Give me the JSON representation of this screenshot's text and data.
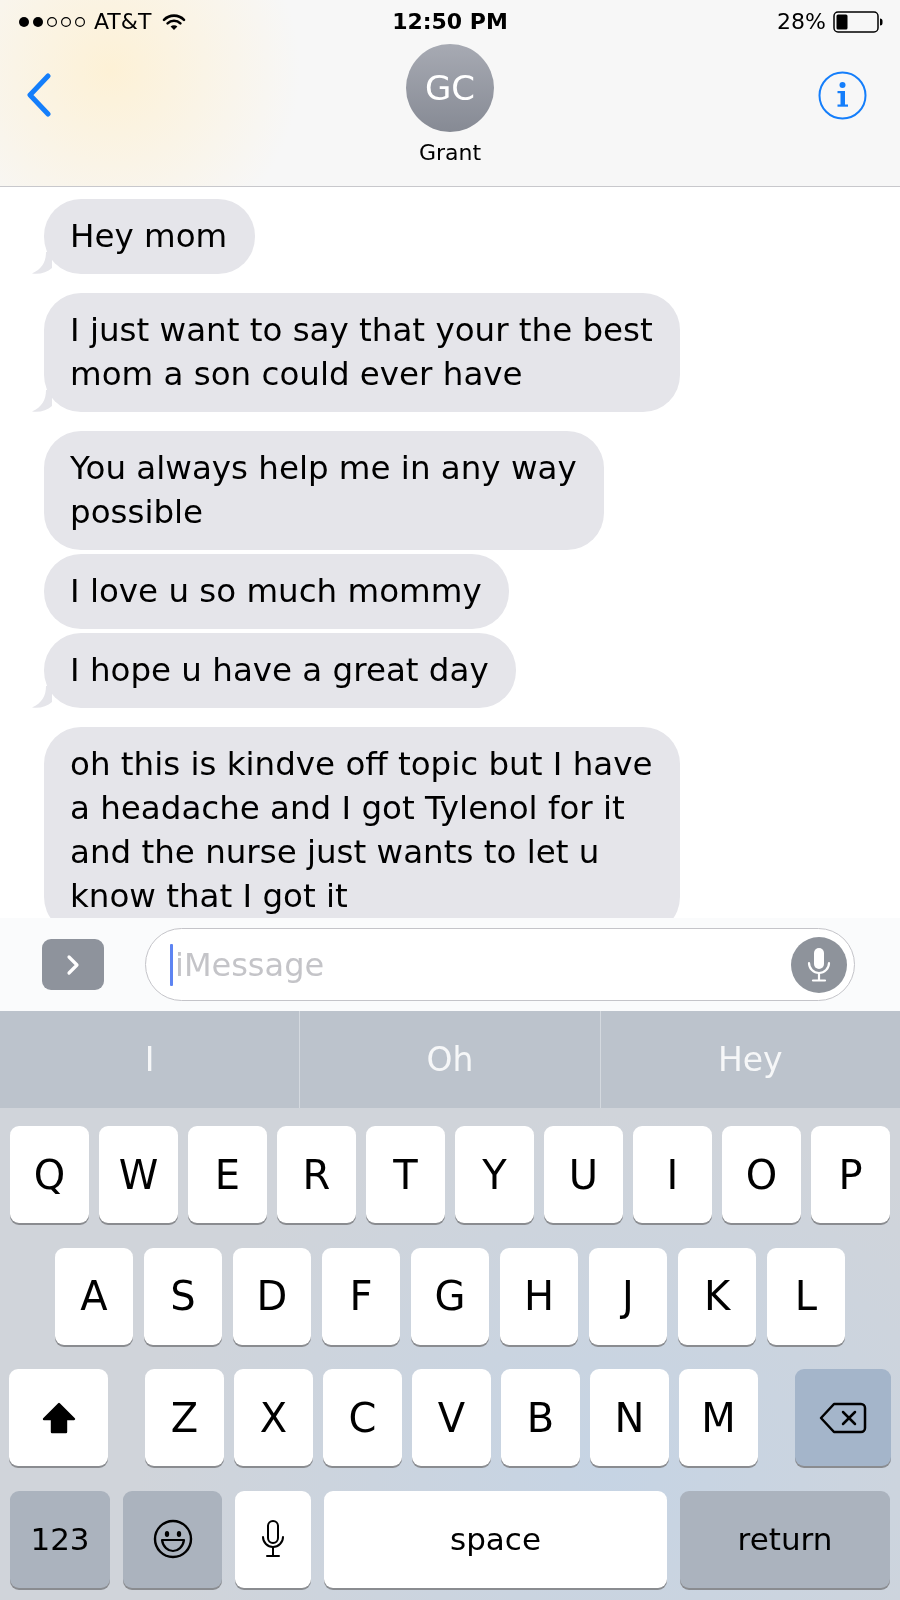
{
  "status_bar": {
    "carrier": "AT&T",
    "time": "12:50 PM",
    "battery": "28%"
  },
  "header": {
    "avatar_initials": "GC",
    "contact_name": "Grant"
  },
  "messages": [
    {
      "text": "Hey mom",
      "tail": true
    },
    {
      "text": "I just want to say that your the best mom a son could ever have",
      "tail": true
    },
    {
      "text": "You always help me in any way possible",
      "tail": false
    },
    {
      "text": "I love u so much mommy",
      "tail": false
    },
    {
      "text": "I hope u have a great day",
      "tail": true
    },
    {
      "text": "oh this is kindve off topic but I have a headache and I got Tylenol for it and the nurse just wants to let u know that I got it",
      "tail": false
    }
  ],
  "composer": {
    "placeholder": "iMessage"
  },
  "keyboard": {
    "suggestions": [
      "I",
      "Oh",
      "Hey"
    ],
    "rows": [
      {
        "keys": [
          {
            "kind": "letter",
            "label": "Q"
          },
          {
            "kind": "letter",
            "label": "W"
          },
          {
            "kind": "letter",
            "label": "E"
          },
          {
            "kind": "letter",
            "label": "R"
          },
          {
            "kind": "letter",
            "label": "T"
          },
          {
            "kind": "letter",
            "label": "Y"
          },
          {
            "kind": "letter",
            "label": "U"
          },
          {
            "kind": "letter",
            "label": "I"
          },
          {
            "kind": "letter",
            "label": "O"
          },
          {
            "kind": "letter",
            "label": "P"
          }
        ]
      },
      {
        "keys": [
          {
            "kind": "letter",
            "label": "A"
          },
          {
            "kind": "letter",
            "label": "S"
          },
          {
            "kind": "letter",
            "label": "D"
          },
          {
            "kind": "letter",
            "label": "F"
          },
          {
            "kind": "letter",
            "label": "G"
          },
          {
            "kind": "letter",
            "label": "H"
          },
          {
            "kind": "letter",
            "label": "J"
          },
          {
            "kind": "letter",
            "label": "K"
          },
          {
            "kind": "letter",
            "label": "L"
          }
        ]
      },
      {
        "keys": [
          {
            "kind": "shift",
            "on": true
          },
          {
            "kind": "letter",
            "label": "Z"
          },
          {
            "kind": "letter",
            "label": "X"
          },
          {
            "kind": "letter",
            "label": "C"
          },
          {
            "kind": "letter",
            "label": "V"
          },
          {
            "kind": "letter",
            "label": "B"
          },
          {
            "kind": "letter",
            "label": "N"
          },
          {
            "kind": "letter",
            "label": "M"
          },
          {
            "kind": "delete"
          }
        ]
      },
      {
        "keys": [
          {
            "kind": "mode",
            "label": "123"
          },
          {
            "kind": "emoji"
          },
          {
            "kind": "dictation"
          },
          {
            "kind": "space",
            "label": "space"
          },
          {
            "kind": "return",
            "label": "return"
          }
        ]
      }
    ]
  }
}
